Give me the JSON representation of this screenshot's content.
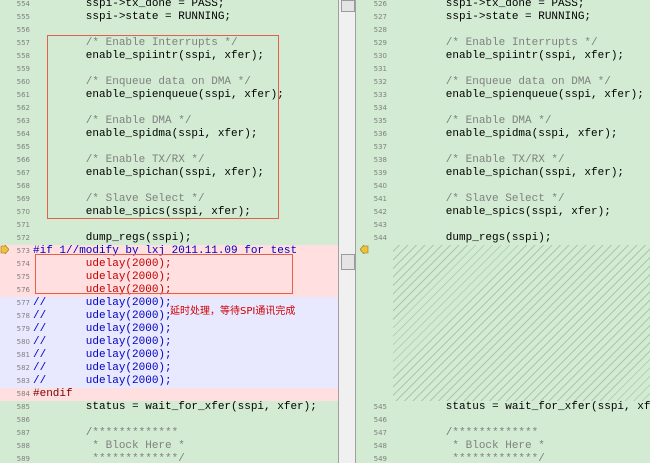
{
  "left": {
    "lines": [
      {
        "num": "554",
        "text": "        sspi->tx_done = PASS;",
        "type": "eq",
        "color": "code"
      },
      {
        "num": "555",
        "text": "        sspi->state = RUNNING;",
        "type": "eq",
        "color": "code"
      },
      {
        "num": "556",
        "text": "",
        "type": "eq",
        "color": "code"
      },
      {
        "num": "557",
        "text": "        /* Enable Interrupts */",
        "type": "eq",
        "color": "comment"
      },
      {
        "num": "558",
        "text": "        enable_spiintr(sspi, xfer);",
        "type": "eq",
        "color": "code"
      },
      {
        "num": "559",
        "text": "",
        "type": "eq",
        "color": "code"
      },
      {
        "num": "560",
        "text": "        /* Enqueue data on DMA */",
        "type": "eq",
        "color": "comment"
      },
      {
        "num": "561",
        "text": "        enable_spienqueue(sspi, xfer);",
        "type": "eq",
        "color": "code"
      },
      {
        "num": "562",
        "text": "",
        "type": "eq",
        "color": "code"
      },
      {
        "num": "563",
        "text": "        /* Enable DMA */",
        "type": "eq",
        "color": "comment"
      },
      {
        "num": "564",
        "text": "        enable_spidma(sspi, xfer);",
        "type": "eq",
        "color": "code"
      },
      {
        "num": "565",
        "text": "",
        "type": "eq",
        "color": "code"
      },
      {
        "num": "566",
        "text": "        /* Enable TX/RX */",
        "type": "eq",
        "color": "comment"
      },
      {
        "num": "567",
        "text": "        enable_spichan(sspi, xfer);",
        "type": "eq",
        "color": "code"
      },
      {
        "num": "568",
        "text": "",
        "type": "eq",
        "color": "code"
      },
      {
        "num": "569",
        "text": "        /* Slave Select */",
        "type": "eq",
        "color": "comment"
      },
      {
        "num": "570",
        "text": "        enable_spics(sspi, xfer);",
        "type": "eq",
        "color": "code"
      },
      {
        "num": "571",
        "text": "",
        "type": "eq",
        "color": "code"
      },
      {
        "num": "572",
        "text": "        dump_regs(sspi);",
        "type": "eq",
        "color": "code"
      },
      {
        "num": "573",
        "text": "#if 1//modify by lxj 2011.11.09 for test",
        "type": "del-dir",
        "color": "dirblue"
      },
      {
        "num": "574",
        "text": "        udelay(2000);",
        "type": "del-dir",
        "color": "red"
      },
      {
        "num": "575",
        "text": "        udelay(2000);",
        "type": "del-dir",
        "color": "red"
      },
      {
        "num": "576",
        "text": "        udelay(2000);",
        "type": "del-dir",
        "color": "red"
      },
      {
        "num": "577",
        "text": "//      udelay(2000);",
        "type": "del-cmt",
        "color": "blue"
      },
      {
        "num": "578",
        "text": "//      udelay(2000);",
        "type": "del-cmt",
        "color": "blue"
      },
      {
        "num": "579",
        "text": "//      udelay(2000);",
        "type": "del-cmt",
        "color": "blue"
      },
      {
        "num": "580",
        "text": "//      udelay(2000);",
        "type": "del-cmt",
        "color": "blue"
      },
      {
        "num": "581",
        "text": "//      udelay(2000);",
        "type": "del-cmt",
        "color": "blue"
      },
      {
        "num": "582",
        "text": "//      udelay(2000);",
        "type": "del-cmt",
        "color": "blue"
      },
      {
        "num": "583",
        "text": "//      udelay(2000);",
        "type": "del-cmt",
        "color": "blue"
      },
      {
        "num": "584",
        "text": "#endif",
        "type": "del-dir",
        "color": "dir"
      },
      {
        "num": "585",
        "text": "        status = wait_for_xfer(sspi, xfer);",
        "type": "eq",
        "color": "code"
      },
      {
        "num": "586",
        "text": "",
        "type": "eq",
        "color": "code"
      },
      {
        "num": "587",
        "text": "        /*************",
        "type": "eq",
        "color": "comment"
      },
      {
        "num": "588",
        "text": "         * Block Here *",
        "type": "eq",
        "color": "comment"
      },
      {
        "num": "589",
        "text": "         *************/",
        "type": "eq",
        "color": "comment"
      }
    ]
  },
  "right": {
    "lines": [
      {
        "num": "526",
        "text": "        sspi->tx_done = PASS;",
        "color": "code"
      },
      {
        "num": "527",
        "text": "        sspi->state = RUNNING;",
        "color": "code"
      },
      {
        "num": "528",
        "text": "",
        "color": "code"
      },
      {
        "num": "529",
        "text": "        /* Enable Interrupts */",
        "color": "comment"
      },
      {
        "num": "530",
        "text": "        enable_spiintr(sspi, xfer);",
        "color": "code"
      },
      {
        "num": "531",
        "text": "",
        "color": "code"
      },
      {
        "num": "532",
        "text": "        /* Enqueue data on DMA */",
        "color": "comment"
      },
      {
        "num": "533",
        "text": "        enable_spienqueue(sspi, xfer);",
        "color": "code"
      },
      {
        "num": "534",
        "text": "",
        "color": "code"
      },
      {
        "num": "535",
        "text": "        /* Enable DMA */",
        "color": "comment"
      },
      {
        "num": "536",
        "text": "        enable_spidma(sspi, xfer);",
        "color": "code"
      },
      {
        "num": "537",
        "text": "",
        "color": "code"
      },
      {
        "num": "538",
        "text": "        /* Enable TX/RX */",
        "color": "comment"
      },
      {
        "num": "539",
        "text": "        enable_spichan(sspi, xfer);",
        "color": "code"
      },
      {
        "num": "540",
        "text": "",
        "color": "code"
      },
      {
        "num": "541",
        "text": "        /* Slave Select */",
        "color": "comment"
      },
      {
        "num": "542",
        "text": "        enable_spics(sspi, xfer);",
        "color": "code"
      },
      {
        "num": "543",
        "text": "",
        "color": "code"
      },
      {
        "num": "544",
        "text": "        dump_regs(sspi);",
        "color": "code"
      },
      {
        "num": "545",
        "text": "        status = wait_for_xfer(sspi, xfer);",
        "color": "code"
      },
      {
        "num": "546",
        "text": "",
        "color": "code"
      },
      {
        "num": "547",
        "text": "        /*************",
        "color": "comment"
      },
      {
        "num": "548",
        "text": "         * Block Here *",
        "color": "comment"
      },
      {
        "num": "549",
        "text": "         *************/",
        "color": "comment"
      }
    ]
  },
  "annotation": "延时处理，等待SPI通讯完成",
  "colors": {
    "equal_bg": "#d2ebd2",
    "deleted_bg": "#ffdfdf",
    "commented_bg": "#e8e8ff",
    "highlight_box": "#e0604a",
    "annotation_text": "#d00000"
  },
  "icons": {
    "diff_marker_left": "right-arrow-icon",
    "diff_marker_right": "left-arrow-icon"
  }
}
